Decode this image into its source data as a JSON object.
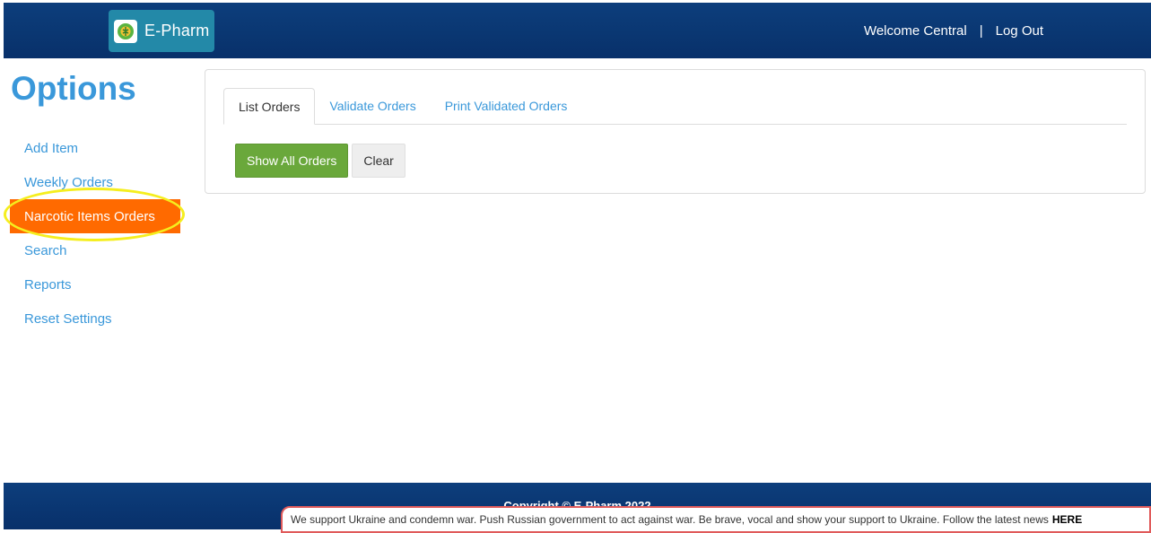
{
  "header": {
    "logo_text": "E-Pharm",
    "logo_icon": "caduceus-pill-icon",
    "welcome": "Welcome Central",
    "separator": "|",
    "logout": "Log Out"
  },
  "sidebar": {
    "title": "Options",
    "items": [
      {
        "label": "Add Item"
      },
      {
        "label": "Weekly Orders"
      },
      {
        "label": "Narcotic Items Orders",
        "active": true
      },
      {
        "label": "Search"
      },
      {
        "label": "Reports"
      },
      {
        "label": "Reset Settings"
      }
    ],
    "active_color": "#ff6a00",
    "highlight_color": "#f5ee1e"
  },
  "main": {
    "tabs": [
      {
        "label": "List Orders",
        "active": true
      },
      {
        "label": "Validate Orders"
      },
      {
        "label": "Print Validated Orders"
      }
    ],
    "buttons": {
      "show_all": "Show All Orders",
      "clear": "Clear"
    },
    "accent_color": "#6aa83b"
  },
  "footer": {
    "copyright": "Copyright © E-Pharm 2022"
  },
  "banner": {
    "text": "We support Ukraine and condemn war. Push Russian government to act against war. Be brave, vocal and show your support to Ukraine. Follow the latest news",
    "link": "HERE"
  }
}
